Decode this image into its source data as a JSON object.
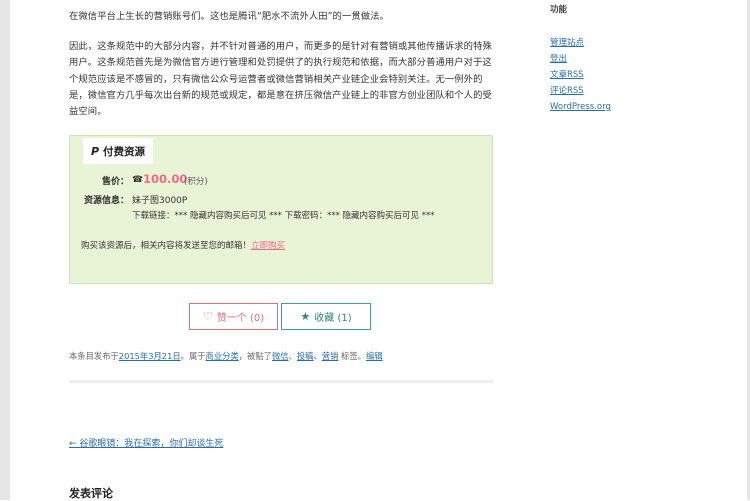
{
  "article": {
    "p1_line1": "在微信平台上生长的营销账号们。这也是腾讯“肥水不流外人田”的一贯做法。",
    "p2": "因此，这条规范中的大部分内容，并不针对普通的用户，而更多的是针对有营销或其他传播诉求的特殊用户。这条规范首先是为微信官方进行管理和处罚提供了的执行规范和依据，而大部分普通用户对于这个规范应该是不感冒的，只有微信公众号运营者或微信营销相关产业链企业会特别关注。无一例外的是，微信官方几乎每次出台新的规范或规定，都是意在挤压微信产业链上的非官方创业团队和个人的受益空间。"
  },
  "pay_box": {
    "title_icon": "P",
    "title": "付费资源",
    "price_label": "售价：",
    "price_icon": "☎",
    "price_value": "100.00",
    "price_unit": "(积分)",
    "resource_label": "资源信息：",
    "resource_name": "妹子图3000P",
    "download_text": "下载链接：*** 隐藏内容购买后可见 ***   下载密码：*** 隐藏内容购买后可见 ***",
    "notice_text": "购买该资源后，相关内容将发送至您的邮箱！",
    "buy_link": "立即购买"
  },
  "buttons": {
    "like_label": "赞一个 (0)",
    "fav_label": "收藏 (1)"
  },
  "meta": {
    "prefix": "本条目发布于",
    "date": "2015年3月21日",
    "mid1": "。属于",
    "category": "商业分类",
    "mid2": "，被贴了",
    "tag1": "微信",
    "sep1": "、",
    "tag2": "投稿",
    "sep2": "、",
    "tag3": "营销",
    "mid3": " 标签。",
    "edit": "编辑"
  },
  "nav": {
    "prev_link": "← 谷歌眼镜：我在探索，你们却谈生死"
  },
  "comments": {
    "heading": "发表评论"
  },
  "sidebar": {
    "heading": "功能",
    "links": [
      "管理站点",
      "登出",
      "文章RSS",
      "评论RSS",
      "WordPress.org"
    ]
  },
  "colors": {
    "accent_pink": "#ef6a8a",
    "accent_green": "#3aa58c",
    "link_blue": "#2a6ea6",
    "box_bg": "#e9f4d6"
  }
}
